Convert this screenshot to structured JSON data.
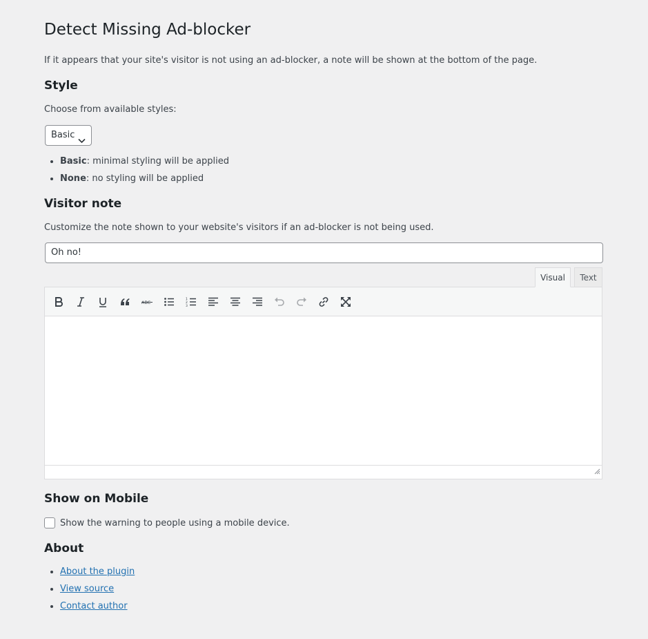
{
  "page": {
    "title": "Detect Missing Ad-blocker",
    "intro": "If it appears that your site's visitor is not using an ad-blocker, a note will be shown at the bottom of the page."
  },
  "style_section": {
    "heading": "Style",
    "prompt": "Choose from available styles:",
    "select_value": "Basic",
    "options": [
      {
        "name": "Basic",
        "desc": ": minimal styling will be applied"
      },
      {
        "name": "None",
        "desc": ": no styling will be applied"
      }
    ]
  },
  "visitor_note": {
    "heading": "Visitor note",
    "prompt": "Customize the note shown to your website's visitors if an ad-blocker is not being used.",
    "title_value": "Oh no!",
    "tabs": {
      "visual": "Visual",
      "text": "Text"
    },
    "toolbar_icons": [
      "bold-icon",
      "italic-icon",
      "underline-icon",
      "blockquote-icon",
      "strikethrough-icon",
      "bullet-list-icon",
      "numbered-list-icon",
      "align-left-icon",
      "align-center-icon",
      "align-right-icon",
      "undo-icon",
      "redo-icon",
      "link-icon",
      "fullscreen-icon"
    ]
  },
  "mobile": {
    "heading": "Show on Mobile",
    "checkbox_label": "Show the warning to people using a mobile device.",
    "checked": false
  },
  "about": {
    "heading": "About",
    "links": [
      "About the plugin",
      "View source",
      "Contact author"
    ]
  }
}
